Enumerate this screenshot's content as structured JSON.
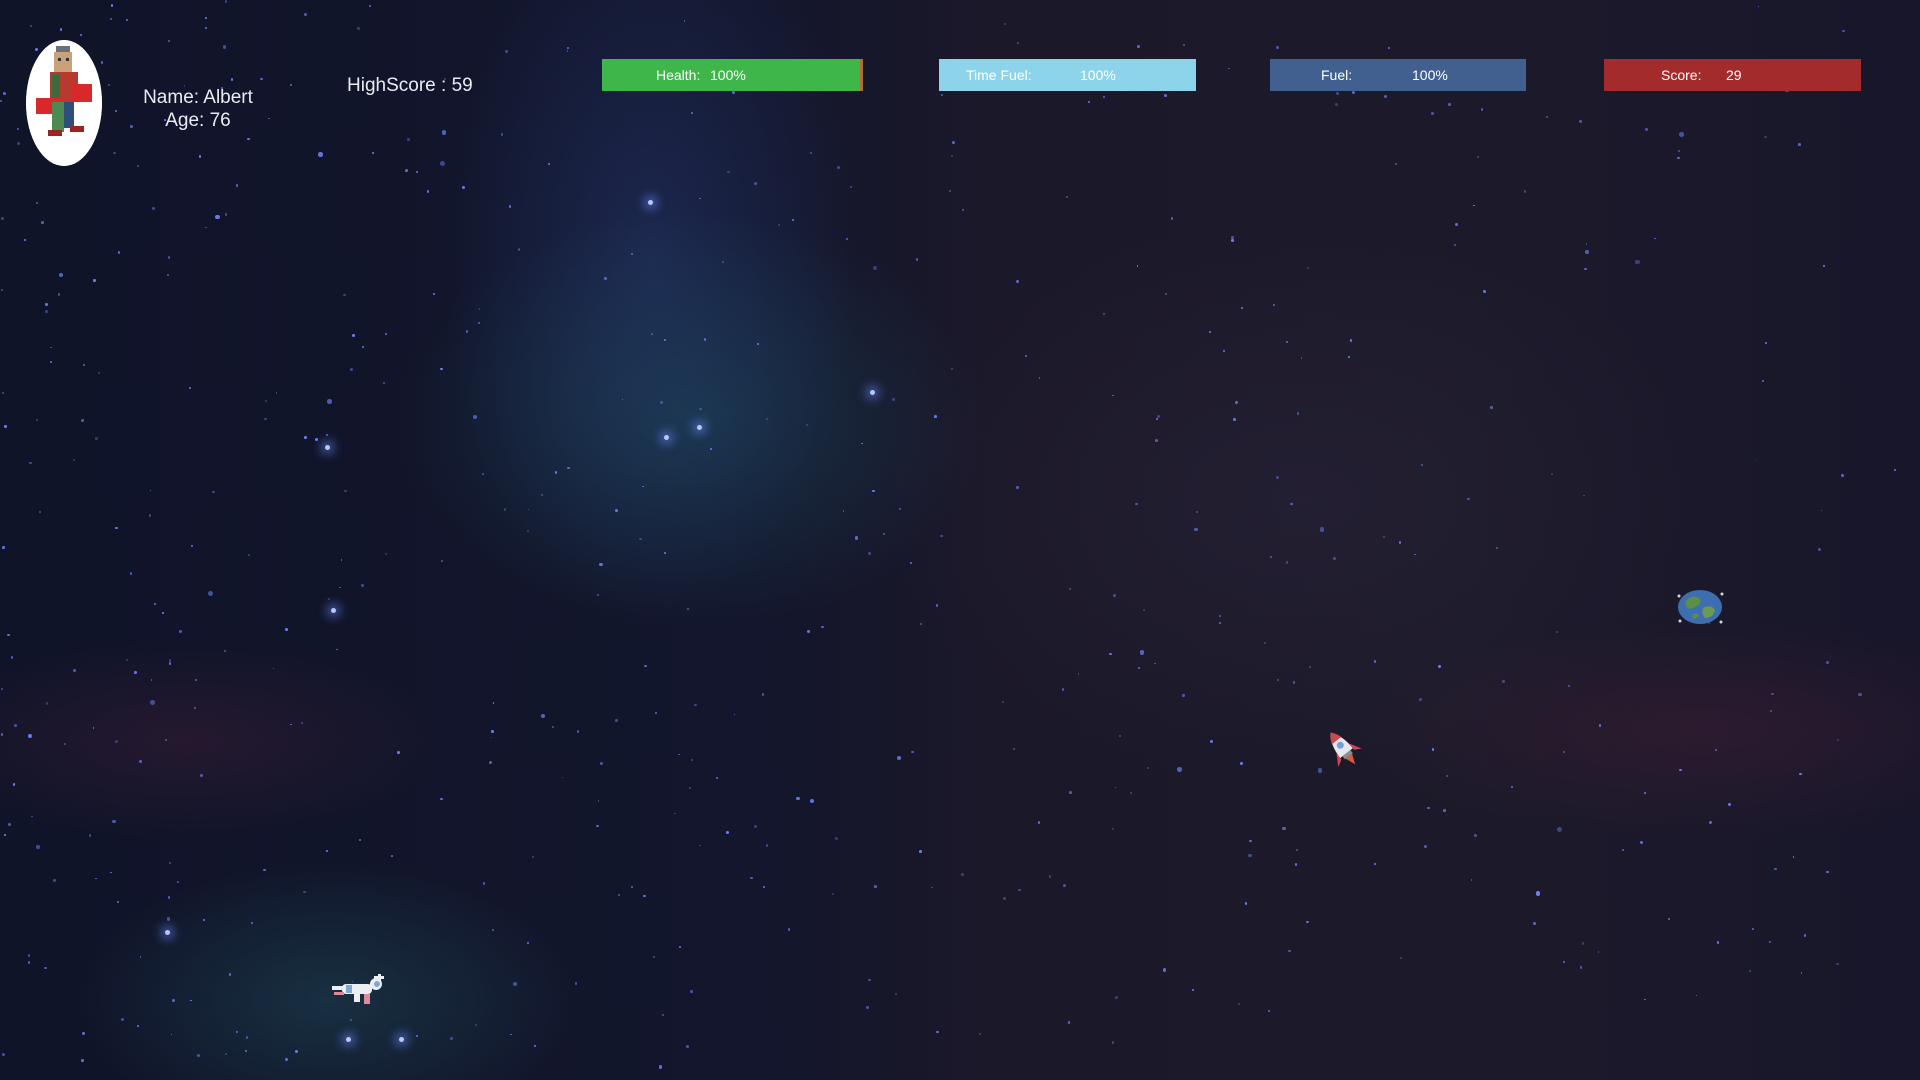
{
  "player": {
    "name_label": "Name:",
    "name": "Albert",
    "age_label": "Age:",
    "age": "76",
    "avatar_icon": "player-portrait-icon"
  },
  "highscore": {
    "label": "HighScore :",
    "value": "59"
  },
  "hud": {
    "health": {
      "label": "Health:",
      "value": "100%",
      "fraction": 1.0,
      "color": "#3fb64a"
    },
    "time_fuel": {
      "label": "Time Fuel:",
      "value": "100%",
      "fraction": 1.0,
      "color": "#8dd3ea"
    },
    "fuel": {
      "label": "Fuel:",
      "value": "100%",
      "fraction": 1.0,
      "color": "#41608f"
    },
    "score": {
      "label": "Score:",
      "value": "29",
      "color": "#a42b2b"
    }
  },
  "sprites": {
    "planet": "earth-planet-icon",
    "rocket": "rocket-ship-icon",
    "astronaut": "floating-astronaut-icon"
  },
  "background": {
    "theme": "deep space nebula",
    "base_color": "#101429"
  }
}
